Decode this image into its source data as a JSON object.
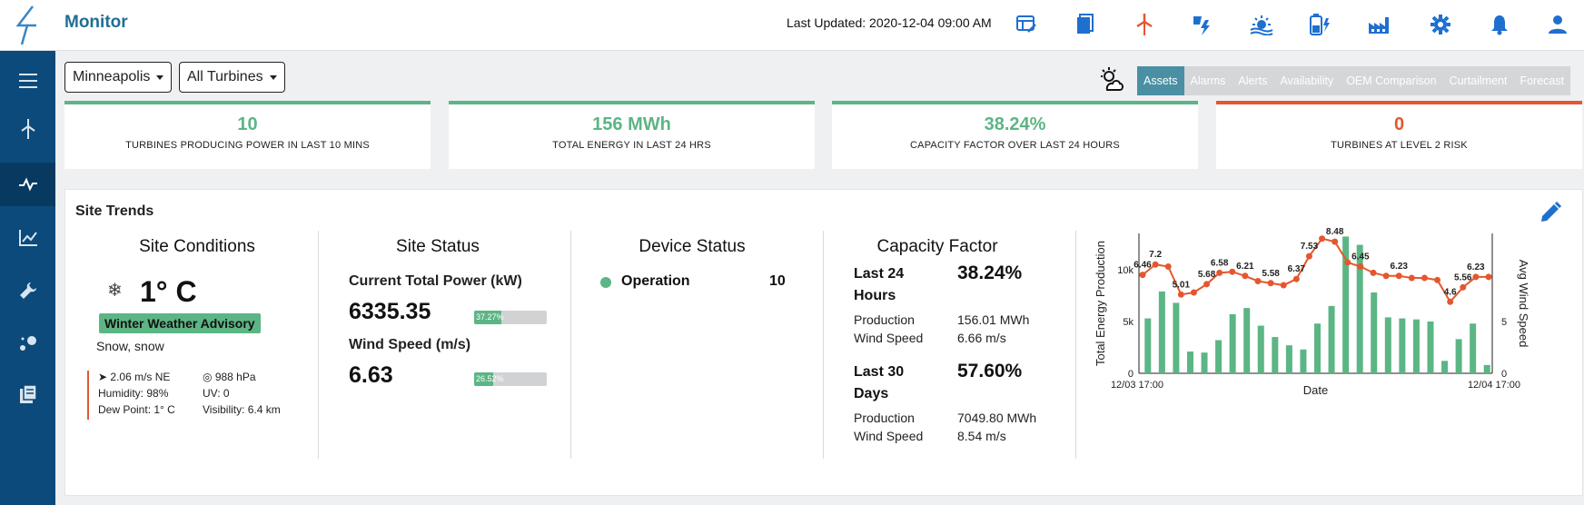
{
  "app": {
    "title": "Monitor",
    "last_updated": "Last Updated: 2020-12-04 09:00 AM"
  },
  "top_icons": [
    {
      "name": "dashboard-icon",
      "color": "#1f6fcf"
    },
    {
      "name": "document-icon",
      "color": "#1f6fcf"
    },
    {
      "name": "wind-turbine-icon",
      "color": "#e4572e"
    },
    {
      "name": "power-icon",
      "color": "#1f6fcf"
    },
    {
      "name": "sunset-icon",
      "color": "#1f6fcf"
    },
    {
      "name": "battery-icon",
      "color": "#1f6fcf"
    },
    {
      "name": "factory-icon",
      "color": "#1f6fcf"
    },
    {
      "name": "settings-icon",
      "color": "#1f6fcf"
    },
    {
      "name": "bell-icon",
      "color": "#1f6fcf"
    },
    {
      "name": "user-icon",
      "color": "#1f6fcf"
    }
  ],
  "sidebar": [
    "menu-icon",
    "turbine-icon",
    "pulse-icon",
    "trend-chart-icon",
    "wrench-icon",
    "cluster-icon",
    "library-icon"
  ],
  "filters": {
    "location": "Minneapolis",
    "turbines": "All Turbines"
  },
  "tabs": [
    "Assets",
    "Alarms",
    "Alerts",
    "Availability",
    "OEM Comparison",
    "Curtailment",
    "Forecast"
  ],
  "active_tab": "Assets",
  "kpis": [
    {
      "value": "10",
      "label": "TURBINES PRODUCING POWER IN LAST 10 MINS"
    },
    {
      "value": "156 MWh",
      "label": "TOTAL ENERGY IN LAST 24 HRS"
    },
    {
      "value": "38.24%",
      "label": "CAPACITY FACTOR OVER LAST 24 HOURS"
    },
    {
      "value": "0",
      "label": "TURBINES AT LEVEL 2 RISK"
    }
  ],
  "panel": {
    "title": "Site Trends"
  },
  "site_conditions": {
    "title": "Site Conditions",
    "temp": "1° C",
    "advisory": "Winter Weather Advisory",
    "condition": "Snow, snow",
    "wind": "2.06 m/s NE",
    "pressure": "988 hPa",
    "humidity": "Humidity: 98%",
    "uv": "UV: 0",
    "dew_point": "Dew Point: 1° C",
    "visibility": "Visibility: 6.4 km"
  },
  "site_status": {
    "title": "Site Status",
    "power_label": "Current Total Power (kW)",
    "power_value": "6335.35",
    "power_pct": 0.3727,
    "power_pct_text": "37.27%",
    "wind_label": "Wind Speed (m/s)",
    "wind_value": "6.63",
    "wind_pct": 0.2652,
    "wind_pct_text": "26.52%"
  },
  "device_status": {
    "title": "Device Status",
    "label": "Operation",
    "count": "10"
  },
  "capacity_factor": {
    "title": "Capacity Factor",
    "p1_label_a": "Last 24",
    "p1_label_b": "Hours",
    "p1_value": "38.24%",
    "p1_prod_label": "Production",
    "p1_prod": "156.01 MWh",
    "p1_wind_label": "Wind Speed",
    "p1_wind": "6.66 m/s",
    "p2_label_a": "Last 30",
    "p2_label_b": "Days",
    "p2_value": "57.60%",
    "p2_prod_label": "Production",
    "p2_prod": "7049.80 MWh",
    "p2_wind_label": "Wind Speed",
    "p2_wind": "8.54 m/s"
  },
  "chart_data": {
    "type": "bar",
    "xlabel": "Date",
    "ylabel": "Total Energy Production",
    "y2label": "Avg Wind Speed",
    "x_ticks": [
      "12/03 17:00",
      "12/04 17:00"
    ],
    "ylim": [
      0,
      13500
    ],
    "y2lim": [
      0,
      13.5
    ],
    "y_ticks": [
      "0",
      "5k",
      "10k"
    ],
    "y2_ticks": [
      "0",
      "5"
    ],
    "series": [
      {
        "type": "bar",
        "values": [
          5300,
          7900,
          6800,
          2100,
          2000,
          3200,
          5700,
          6300,
          4600,
          3500,
          2700,
          2300,
          4800,
          6500,
          13200,
          12400,
          7800,
          5400,
          5300,
          5200,
          5000,
          1200,
          3300,
          4800,
          800
        ]
      },
      {
        "type": "line",
        "values": [
          9.5,
          10.5,
          10.3,
          7.6,
          7.8,
          8.6,
          9.7,
          9.8,
          9.4,
          8.9,
          8.7,
          8.5,
          9.1,
          11.3,
          13.0,
          12.7,
          10.7,
          10.3,
          9.7,
          9.4,
          9.4,
          9.2,
          9.2,
          9.0,
          6.9,
          8.3,
          9.3,
          9.3
        ],
        "labels": [
          {
            "i": 0,
            "text": "6.46"
          },
          {
            "i": 1,
            "text": "7.2"
          },
          {
            "i": 3,
            "text": "5.01"
          },
          {
            "i": 5,
            "text": "5.68"
          },
          {
            "i": 6,
            "text": "6.58"
          },
          {
            "i": 8,
            "text": "6.21"
          },
          {
            "i": 10,
            "text": "5.58"
          },
          {
            "i": 12,
            "text": "6.37"
          },
          {
            "i": 13,
            "text": "7.53"
          },
          {
            "i": 15,
            "text": "8.48"
          },
          {
            "i": 17,
            "text": "6.45"
          },
          {
            "i": 20,
            "text": "6.23"
          },
          {
            "i": 24,
            "text": "4.6"
          },
          {
            "i": 25,
            "text": "5.56"
          },
          {
            "i": 26,
            "text": "6.23"
          }
        ]
      }
    ],
    "bar_color": "#5cb584",
    "line_color": "#e4572e"
  }
}
